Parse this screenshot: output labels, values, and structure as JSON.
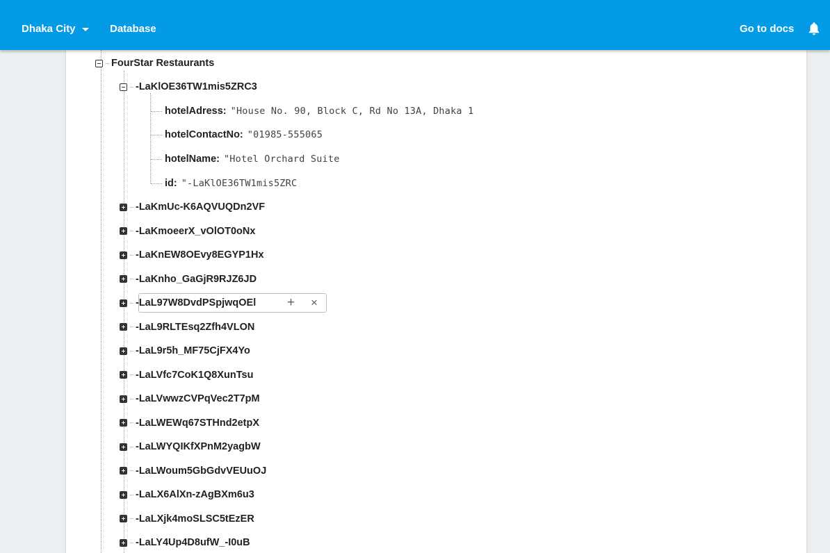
{
  "topbar": {
    "project": "Dhaka City",
    "title": "Database",
    "docs_link": "Go to docs",
    "bell_icon": "notification-bell-icon"
  },
  "tree": {
    "root_label": "FourStar Restaurants",
    "expanded": {
      "key": "-LaKlOE36TW1mis5ZRC3",
      "fields": [
        {
          "name": "hotelAdress:",
          "value": "\"House No. 90, Block C, Rd No 13A, Dhaka 1"
        },
        {
          "name": "hotelContactNo:",
          "value": "\"01985-555065"
        },
        {
          "name": "hotelName:",
          "value": "\"Hotel Orchard Suite"
        },
        {
          "name": "id:",
          "value": "\"-LaKlOE36TW1mis5ZRC"
        }
      ]
    },
    "collapsed": [
      "-LaKmUc-K6AQVUQDn2VF",
      "-LaKmoeerX_vOlOT0oNx",
      "-LaKnEW8OEvy8EGYP1Hx",
      "-LaKnho_GaGjR9RJZ6JD",
      "-LaL97W8DvdPSpjwqOEl",
      "-LaL9RLTEsq2Zfh4VLON",
      "-LaL9r5h_MF75CjFX4Yo",
      "-LaLVfc7CoK1Q8XunTsu",
      "-LaLVwwzCVPqVec2T7pM",
      "-LaLWEWq67STHnd2etpX",
      "-LaLWYQIKfXPnM2yagbW",
      "-LaLWoum5GbGdvVEUuOJ",
      "-LaLX6AlXn-zAgBXm6u3",
      "-LaLXjk4moSLSC5tEzER",
      "-LaLY4Up4D8ufW_-I0uB"
    ],
    "hover_actions": {
      "add": "+",
      "delete": "×"
    }
  },
  "colors": {
    "topbar": "#039be5",
    "page_bg": "#eceff1"
  }
}
